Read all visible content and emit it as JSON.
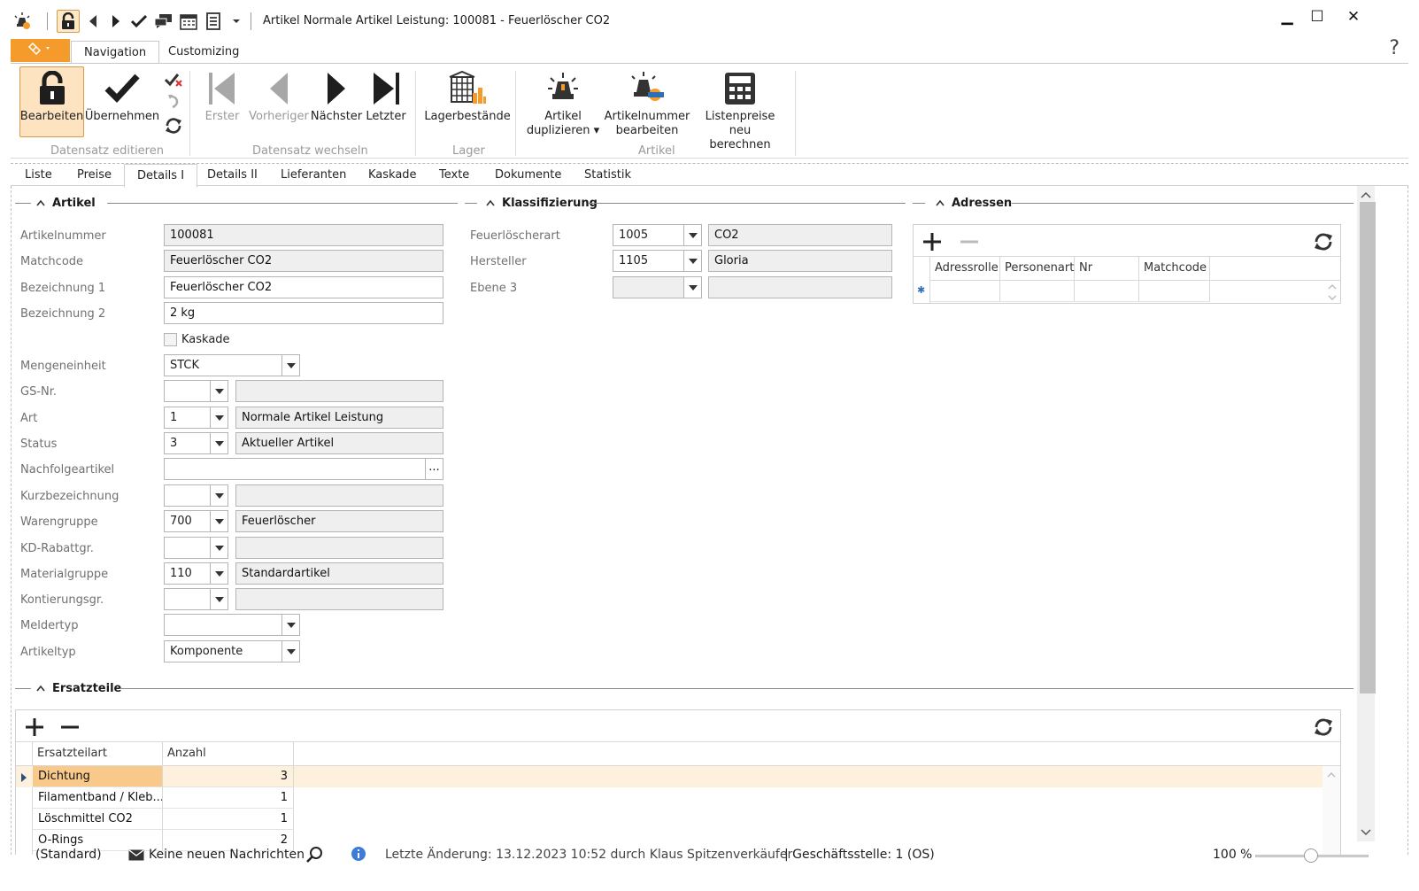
{
  "window": {
    "title": "Artikel Normale Artikel Leistung: 100081 - Feuerlöscher CO2",
    "minimize": "▁",
    "maximize": "☐",
    "close": "✕",
    "help": "?"
  },
  "ribbon_tabs": [
    "Navigation",
    "Customizing"
  ],
  "ribbon": {
    "groups": [
      {
        "label": "Datensatz editieren"
      },
      {
        "label": "Datensatz wechseln"
      },
      {
        "label": "Lager"
      },
      {
        "label": "Artikel"
      }
    ],
    "buttons": {
      "edit": "Bearbeiten",
      "apply": "Übernehmen",
      "first": "Erster",
      "prev": "Vorheriger",
      "next": "Nächster",
      "last": "Letzter",
      "stock": "Lagerbestände",
      "duplicate_1": "Artikel",
      "duplicate_2": "duplizieren ▾",
      "edit_number_1": "Artikelnummer",
      "edit_number_2": "bearbeiten",
      "recalc_1": "Listenpreise neu",
      "recalc_2": "berechnen"
    }
  },
  "content_tabs": [
    "Liste",
    "Preise",
    "Details I",
    "Details II",
    "Lieferanten",
    "Kaskade",
    "Texte",
    "Dokumente",
    "Statistik"
  ],
  "artikel": {
    "heading": "Artikel",
    "artikelnummer": {
      "label": "Artikelnummer",
      "value": "100081"
    },
    "matchcode": {
      "label": "Matchcode",
      "value": "Feuerlöscher CO2"
    },
    "bezeichnung1": {
      "label": "Bezeichnung 1",
      "value": "Feuerlöscher CO2"
    },
    "bezeichnung2": {
      "label": "Bezeichnung 2",
      "value": "2 kg"
    },
    "kaskade": {
      "label": "Kaskade"
    },
    "mengeneinheit": {
      "label": "Mengeneinheit",
      "value": "STCK"
    },
    "gsnr": {
      "label": "GS-Nr.",
      "value": "",
      "desc": ""
    },
    "art": {
      "label": "Art",
      "value": "1",
      "desc": "Normale Artikel Leistung"
    },
    "status": {
      "label": "Status",
      "value": "3",
      "desc": "Aktueller Artikel"
    },
    "nachfolgeartikel": {
      "label": "Nachfolgeartikel",
      "value": "",
      "button": "..."
    },
    "kurzbezeichnung": {
      "label": "Kurzbezeichnung",
      "value": "",
      "desc": ""
    },
    "warengruppe": {
      "label": "Warengruppe",
      "value": "700",
      "desc": "Feuerlöscher"
    },
    "kdrabattgr": {
      "label": "KD-Rabattgr.",
      "value": "",
      "desc": ""
    },
    "materialgruppe": {
      "label": "Materialgruppe",
      "value": "110",
      "desc": "Standardartikel"
    },
    "kontierungsgr": {
      "label": "Kontierungsgr.",
      "value": "",
      "desc": ""
    },
    "meldertyp": {
      "label": "Meldertyp",
      "value": ""
    },
    "artikeltyp": {
      "label": "Artikeltyp",
      "value": "Komponente"
    }
  },
  "klassifizierung": {
    "heading": "Klassifizierung",
    "feuerloescherart": {
      "label": "Feuerlöscherart",
      "value": "1005",
      "desc": "CO2"
    },
    "hersteller": {
      "label": "Hersteller",
      "value": "1105",
      "desc": "Gloria"
    },
    "ebene3": {
      "label": "Ebene 3",
      "value": "",
      "desc": ""
    }
  },
  "adressen": {
    "heading": "Adressen",
    "columns": [
      "Adressrolle",
      "Personenart",
      "Nr",
      "Matchcode"
    ],
    "new_row_marker": "✱"
  },
  "ersatzteile": {
    "heading": "Ersatzteile",
    "columns": [
      "Ersatzteilart",
      "Anzahl"
    ],
    "rows": [
      {
        "art": "Dichtung",
        "anzahl": "3"
      },
      {
        "art": "Filamentband / Kleb...",
        "anzahl": "1"
      },
      {
        "art": "Löschmittel CO2",
        "anzahl": "1"
      },
      {
        "art": "O-Rings",
        "anzahl": "2"
      }
    ]
  },
  "status_bar": {
    "profile": "(Standard)",
    "messages": "Keine neuen Nachrichten",
    "last_change": "Letzte Änderung: 13.12.2023 10:52 durch Klaus Spitzenverkäufer",
    "branch": "| Geschäftsstelle:  1 (OS)",
    "zoom": "100 %"
  },
  "colors": {
    "accent": "#f59b2c",
    "selected_row": "#fdf0dc"
  }
}
